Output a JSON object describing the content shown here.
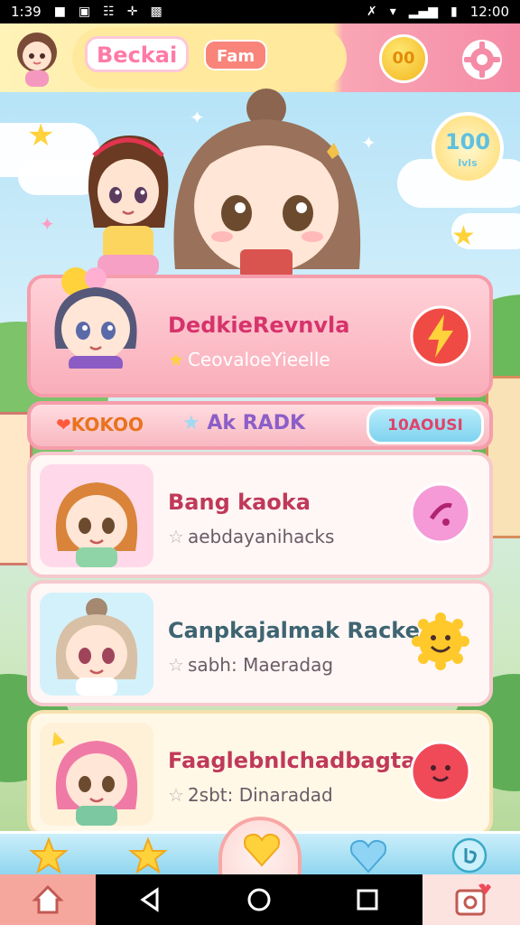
{
  "status_bar": {
    "time": "1:39",
    "clock": "12:00"
  },
  "header": {
    "logo": "Beckai",
    "tag": "Fam",
    "coins": "00"
  },
  "badge": {
    "value": "100",
    "sub": "lvls"
  },
  "featured": {
    "title": "DedkieRevnvla",
    "subtitle": "CeovaloeYieelle",
    "title_color": "#d6336c",
    "action_icon": "lightning-icon"
  },
  "midbar": {
    "left": "KOKOO",
    "center": "Ak RADK",
    "button": "10AOUSI"
  },
  "items": [
    {
      "title": "Bang kaoka",
      "subtitle": "aebdayanihacks",
      "title_color": "#c0395a",
      "portrait_bg": "#ffd9ea",
      "action_icon": "pink-ball-icon"
    },
    {
      "title": "Canpkajalmak Racke",
      "subtitle": "sabh: Maeradag",
      "title_color": "#3e6472",
      "portrait_bg": "#d3f1fb",
      "action_icon": "sun-face-icon"
    },
    {
      "title": "Faaglebnlchadbagtan",
      "subtitle": "2sbt: Dinaradad",
      "title_color": "#c0395a",
      "portrait_bg": "#fff1d8",
      "action_icon": "red-ball-face-icon"
    }
  ],
  "colors": {
    "accent_pink": "#f59dab",
    "accent_yellow": "#ffe99c",
    "sky": "#aee0f6"
  }
}
